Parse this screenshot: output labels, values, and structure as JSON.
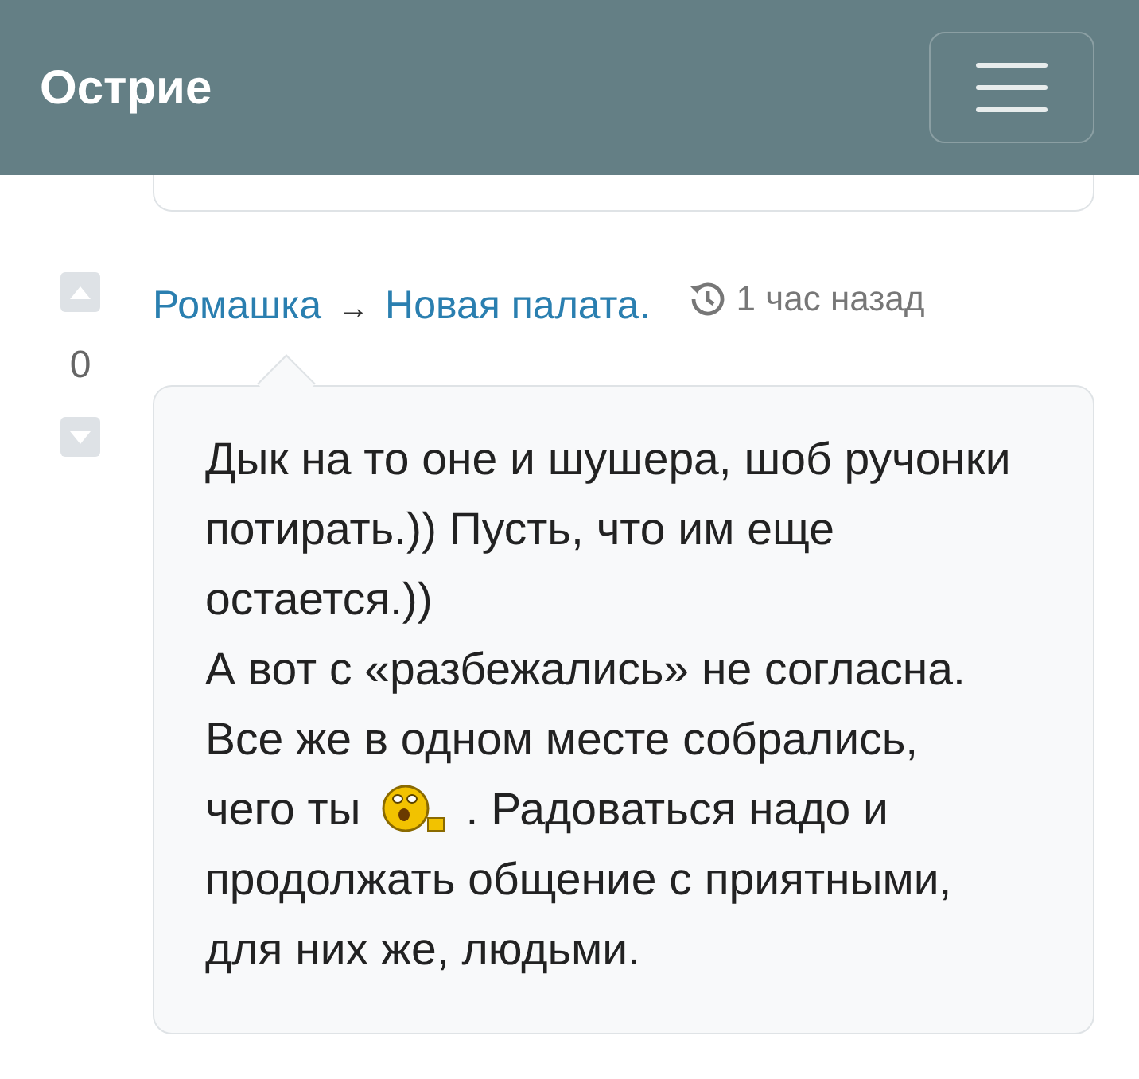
{
  "navbar": {
    "brand": "Острие"
  },
  "comment": {
    "score": "0",
    "author": "Ромашка",
    "arrow": "→",
    "topic": "Новая палата.",
    "time": "1 час назад",
    "body": [
      {
        "kind": "text",
        "text": "Дык на то оне и шушера, шоб ручонки потирать.)) Пусть, что им еще остается.))"
      },
      {
        "kind": "break"
      },
      {
        "kind": "text",
        "text": "А вот с «разбежались» не согласна."
      },
      {
        "kind": "break"
      },
      {
        "kind": "text",
        "text": "Все же в одном месте собрались,"
      },
      {
        "kind": "break"
      },
      {
        "kind": "text",
        "text": "чего ты"
      },
      {
        "kind": "emoji"
      },
      {
        "kind": "text",
        "text": ". Радоваться надо и"
      },
      {
        "kind": "break"
      },
      {
        "kind": "text",
        "text": "продолжать общение с приятными, для них же, людьми."
      }
    ]
  }
}
